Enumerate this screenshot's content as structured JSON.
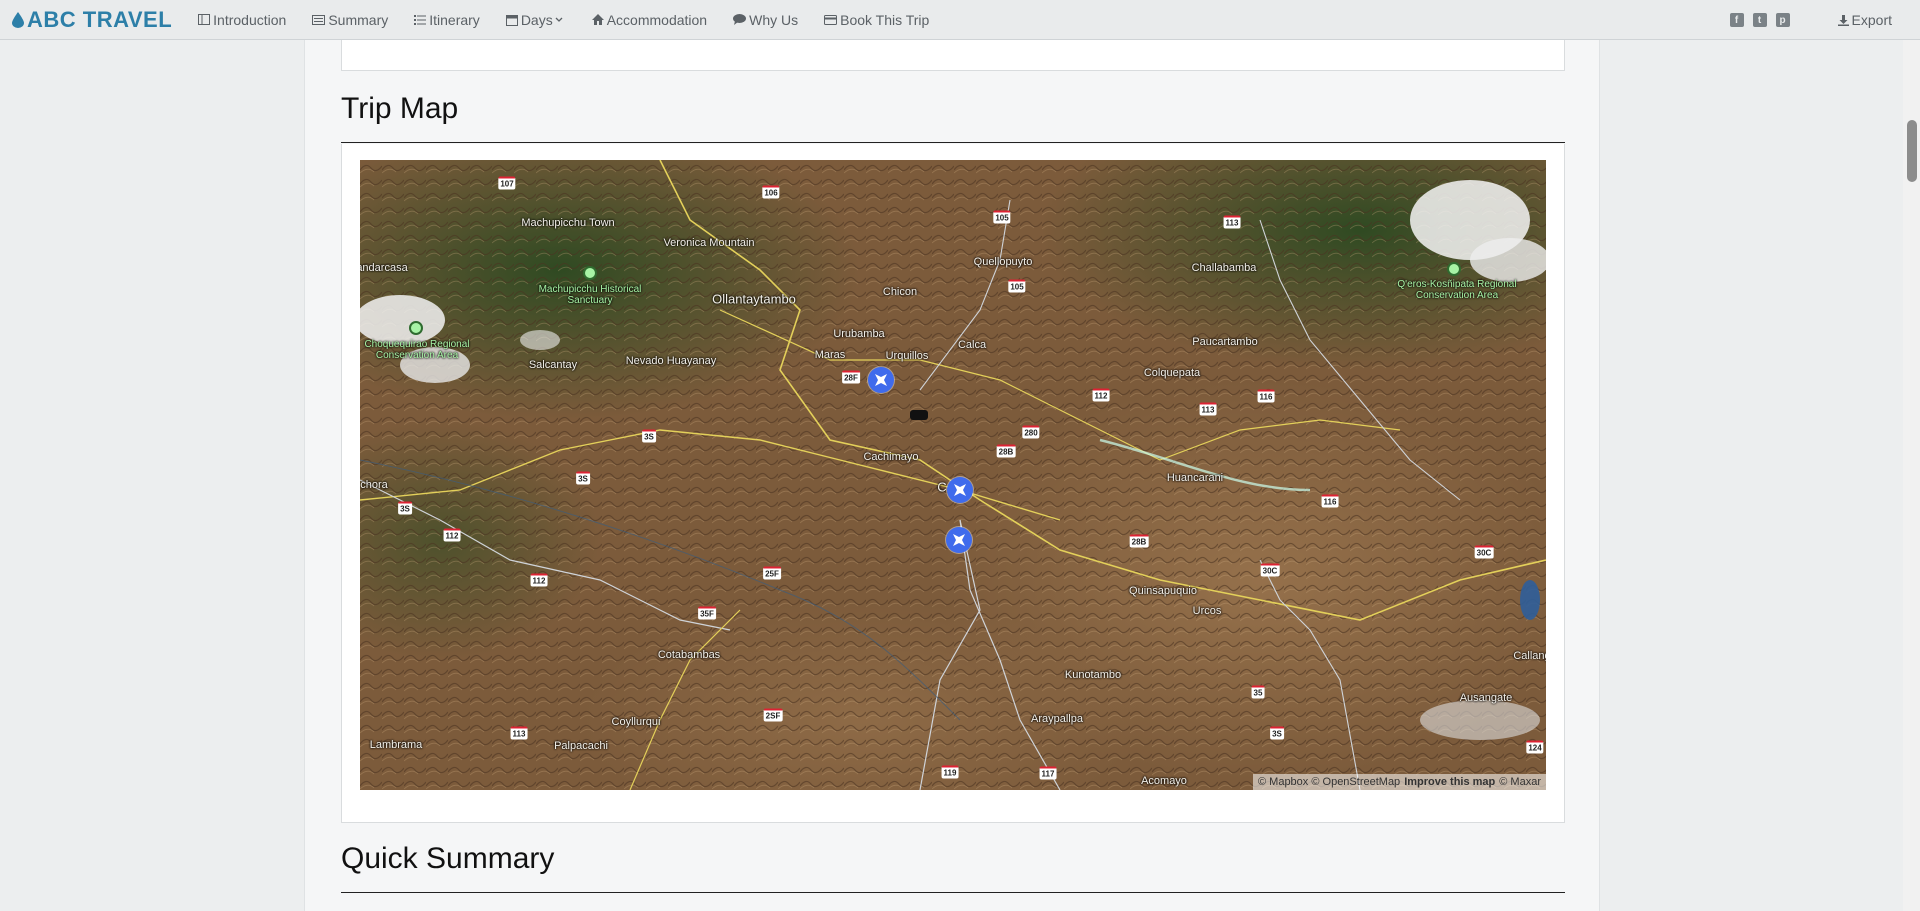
{
  "brand": {
    "name": "ABC TRAVEL",
    "color": "#2d7fa8"
  },
  "nav": {
    "items": [
      {
        "label": "Introduction",
        "icon": "columns-icon"
      },
      {
        "label": "Summary",
        "icon": "card-icon"
      },
      {
        "label": "Itinerary",
        "icon": "list-icon"
      },
      {
        "label": "Days",
        "icon": "calendar-icon"
      },
      {
        "label": "Accommodation",
        "icon": "home-icon"
      },
      {
        "label": "Why Us",
        "icon": "chat-icon"
      },
      {
        "label": "Book This Trip",
        "icon": "credit-card-icon"
      }
    ],
    "social": [
      "facebook-icon",
      "twitter-icon",
      "pinterest-icon"
    ],
    "export_label": "Export"
  },
  "sections": {
    "trip_map_title": "Trip Map",
    "quick_summary_title": "Quick Summary"
  },
  "map": {
    "attribution": {
      "mapbox": "© Mapbox",
      "osm": "© OpenStreetMap",
      "improve": "Improve this map",
      "maxar": "© Maxar"
    },
    "places": {
      "machupicchu_town": "Machupicchu Town",
      "veronica": "Veronica Mountain",
      "ollantaytambo": "Ollantaytambo",
      "chicon": "Chicon",
      "quellopuyto": "Quellopuyto",
      "challabamba": "Challabamba",
      "qeros": "Q'eros-Kosñipata Regional Conservation Area",
      "andarcasa": "andarcasa",
      "machupicchu_sanctuary": "Machupicchu Historical Sanctuary",
      "choquequirao": "Choquequirao Regional Conservation Area",
      "salcantay": "Salcantay",
      "nevado": "Nevado Huayanay",
      "urubamba": "Urubamba",
      "maras": "Maras",
      "urquillos": "Urquillos",
      "calca": "Calca",
      "paucartambo": "Paucartambo",
      "colquepata": "Colquepata",
      "cachimayo": "Cachimayo",
      "huancarani": "Huancarani",
      "chachora": "chora",
      "quinsapuquio": "Quinsapuquio",
      "urcos": "Urcos",
      "cotabambas": "Cotabambas",
      "kunotambo": "Kunotambo",
      "coyllurqui": "Coyllurqui",
      "araypallpa": "Araypallpa",
      "ausangate": "Ausangate",
      "callang": "Callang",
      "lambrama": "Lambrama",
      "palpacachi": "Palpacachi",
      "acomayo": "Acomayo",
      "cusco": "C"
    },
    "shields": [
      "107",
      "106",
      "105",
      "113",
      "105",
      "112",
      "116",
      "113",
      "28F",
      "280",
      "28B",
      "3S",
      "3S",
      "3S",
      "112",
      "116",
      "28B",
      "30C",
      "30C",
      "112",
      "25F",
      "35F",
      "35",
      "3S",
      "113",
      "2SF",
      "119",
      "117",
      "124"
    ]
  }
}
